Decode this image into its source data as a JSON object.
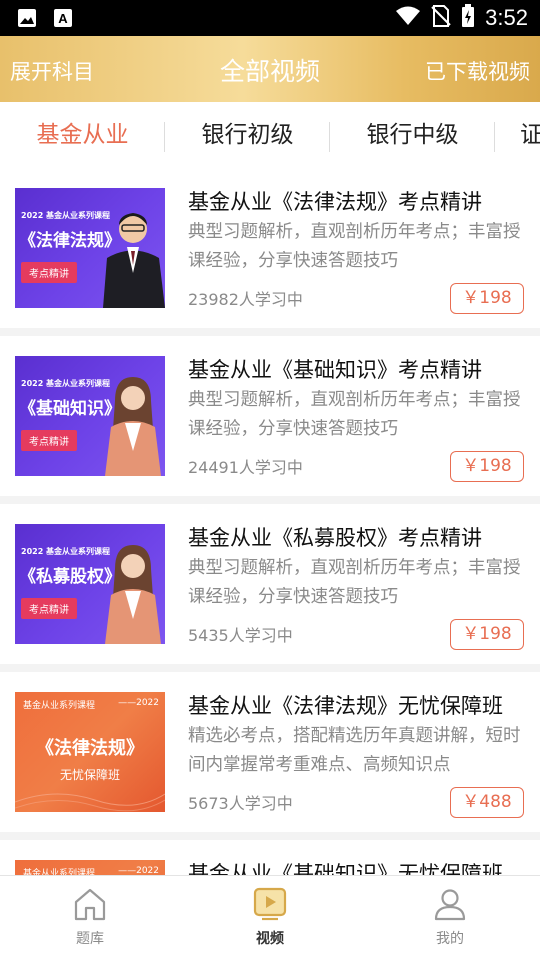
{
  "status_bar": {
    "time": "3:52"
  },
  "header": {
    "left": "展开科目",
    "title": "全部视频",
    "right": "已下载视频"
  },
  "tabs": [
    {
      "label": "基金从业"
    },
    {
      "label": "银行初级"
    },
    {
      "label": "银行中级"
    },
    {
      "label": "证"
    }
  ],
  "courses": [
    {
      "title": "基金从业《法律法规》考点精讲",
      "desc": "典型习题解析，直观剖析历年考点；丰富授课经验，分享快速答题技巧",
      "count": "23982人学习中",
      "price": "￥198",
      "thumb": {
        "series": "2022 基金从业系列课程",
        "big": "《法律法规》",
        "tag": "考点精讲"
      }
    },
    {
      "title": "基金从业《基础知识》考点精讲",
      "desc": "典型习题解析，直观剖析历年考点；丰富授课经验，分享快速答题技巧",
      "count": "24491人学习中",
      "price": "￥198",
      "thumb": {
        "series": "2022 基金从业系列课程",
        "big": "《基础知识》",
        "tag": "考点精讲"
      }
    },
    {
      "title": "基金从业《私募股权》考点精讲",
      "desc": "典型习题解析，直观剖析历年考点；丰富授课经验，分享快速答题技巧",
      "count": "5435人学习中",
      "price": "￥198",
      "thumb": {
        "series": "2022 基金从业系列课程",
        "big": "《私募股权》",
        "tag": "考点精讲"
      }
    },
    {
      "title": "基金从业《法律法规》无忧保障班",
      "desc": "精选必考点，搭配精选历年真题讲解，短时间内掌握常考重难点、高频知识点",
      "count": "5673人学习中",
      "price": "￥488",
      "thumb": {
        "series": "基金从业系列课程",
        "year": "——2022",
        "big": "《法律法规》",
        "sub": "无忧保障班"
      }
    },
    {
      "title": "基金从业《基础知识》无忧保障班",
      "thumb": {
        "series": "基金从业系列课程",
        "year": "——2022"
      }
    }
  ],
  "bottom_nav": [
    {
      "label": "题库"
    },
    {
      "label": "视频"
    },
    {
      "label": "我的"
    }
  ],
  "colors": {
    "accent": "#e86e52",
    "header_gold": "#e8c06b",
    "thumb_purple": "#6e43e8",
    "thumb_orange": "#ef6e3c"
  }
}
